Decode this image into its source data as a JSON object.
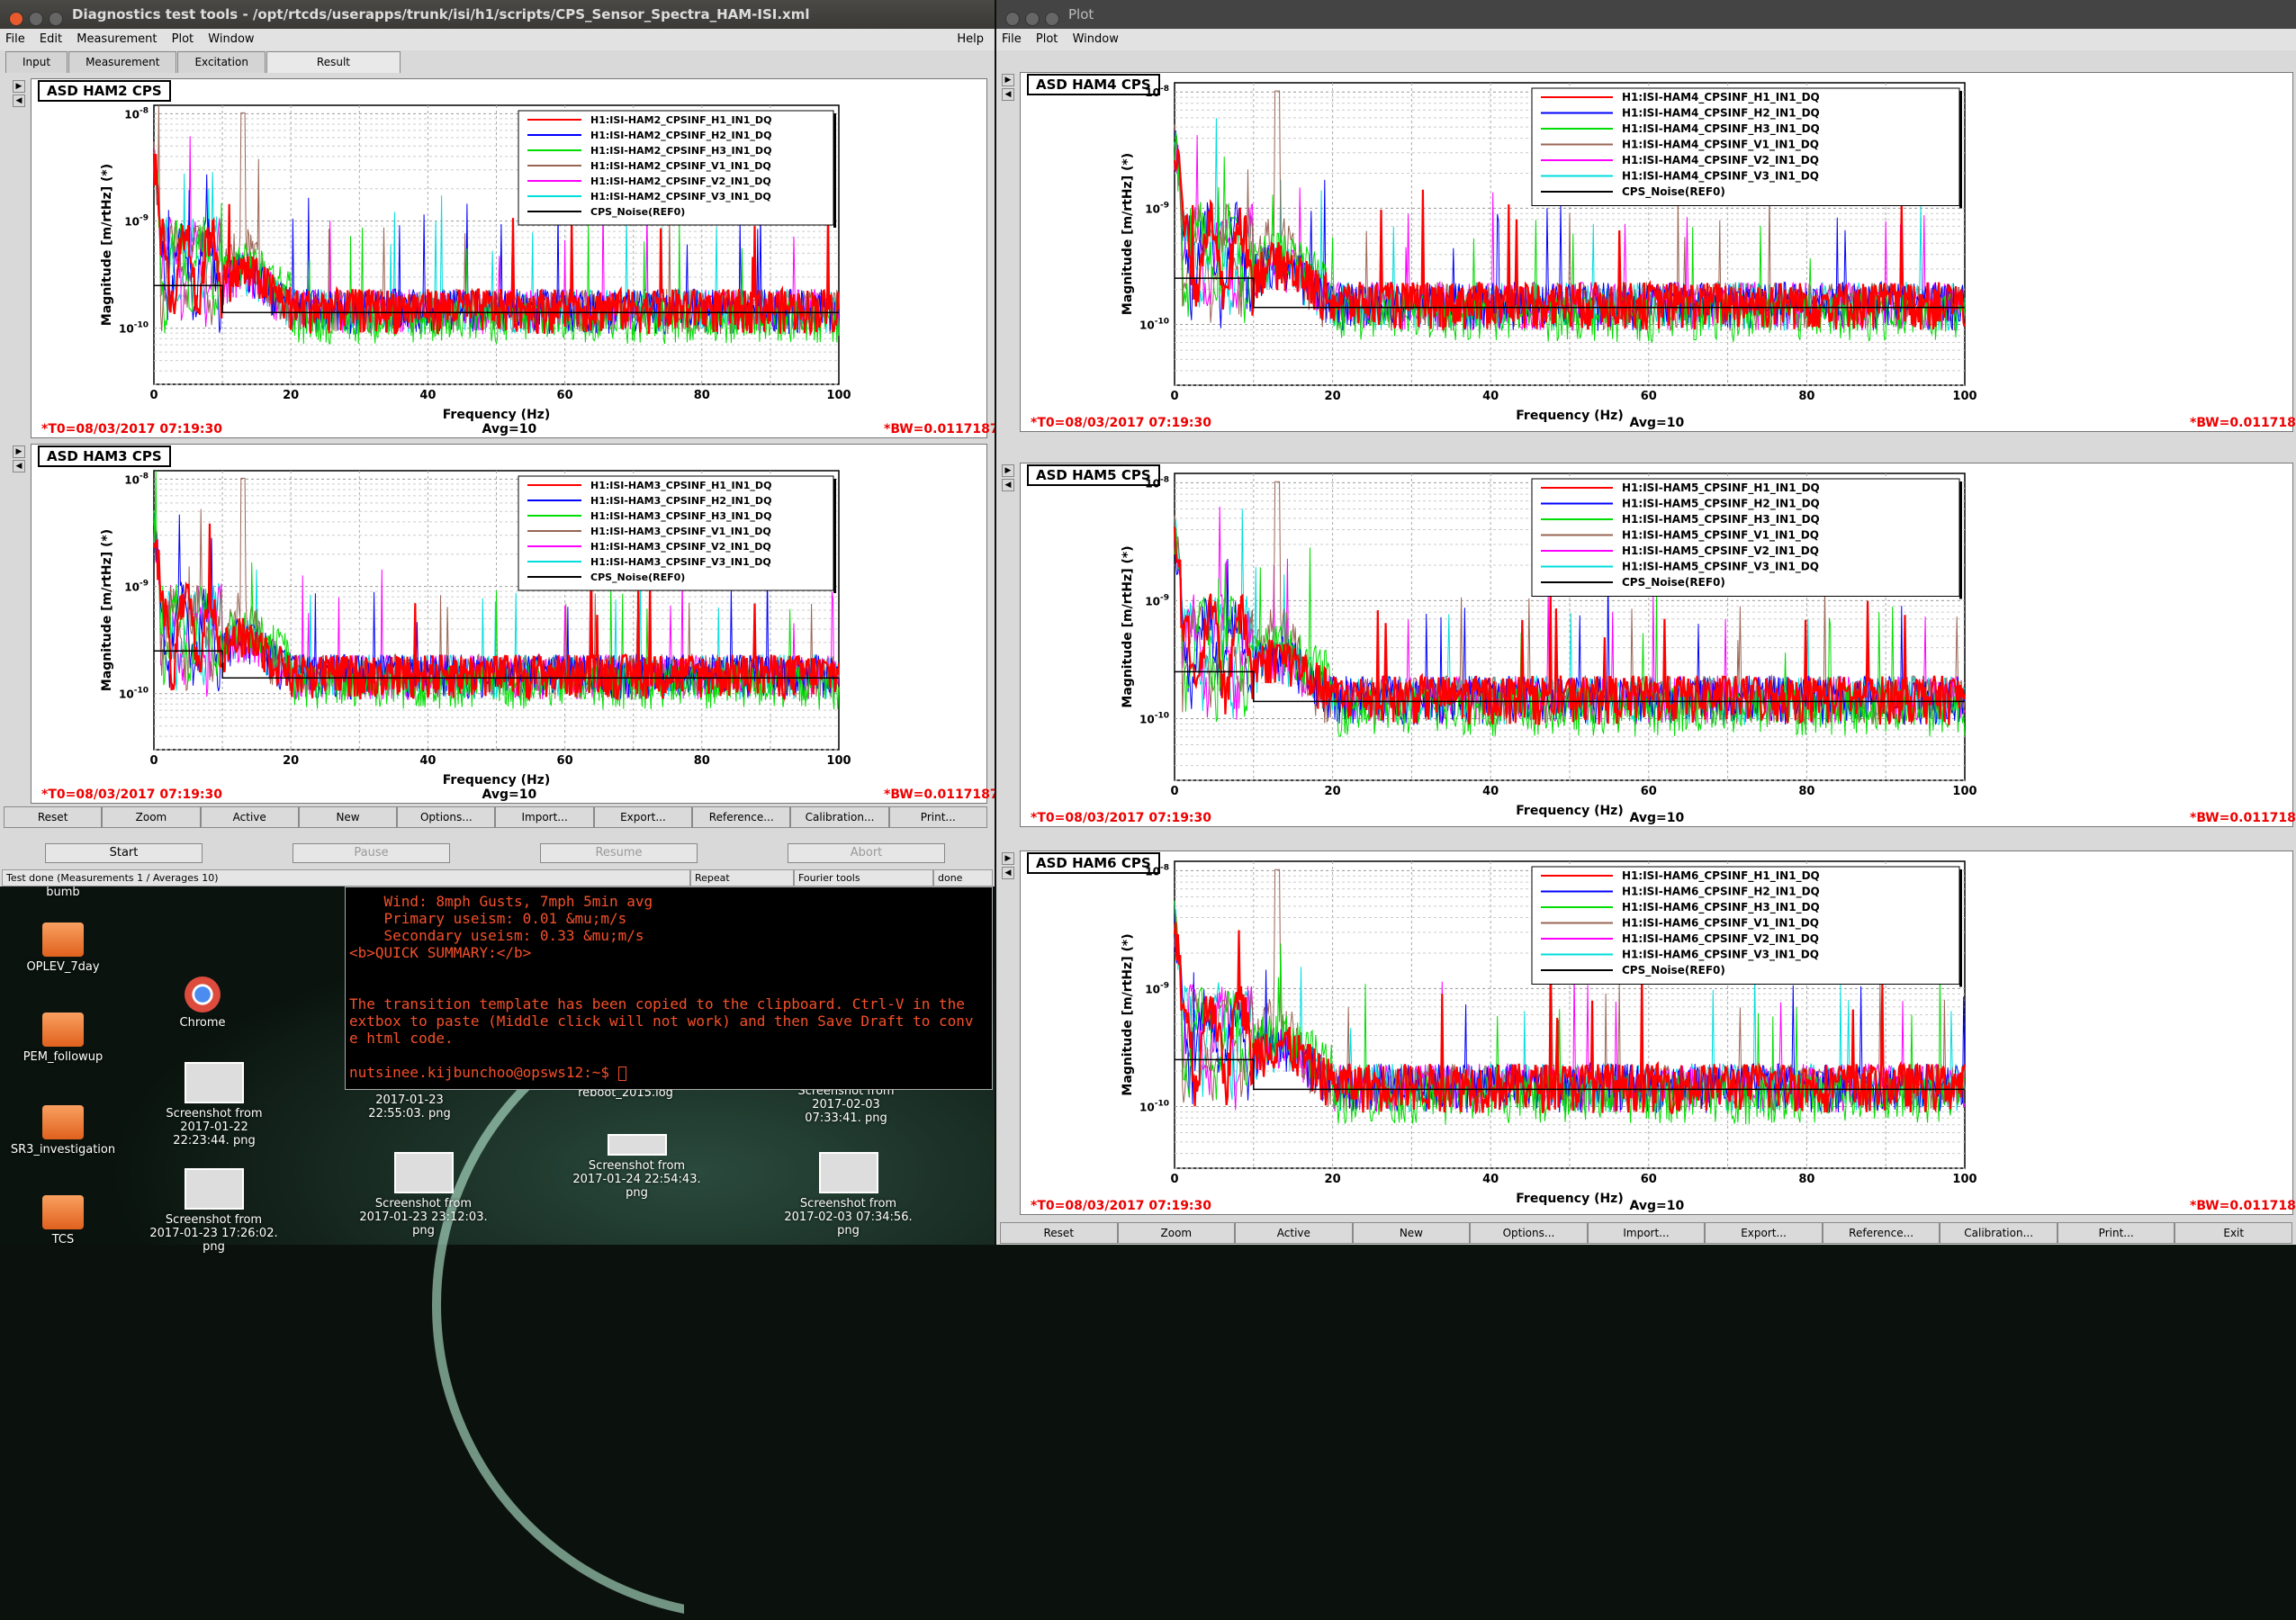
{
  "desktop": {
    "items": [
      {
        "label": "bumb",
        "kind": "text"
      },
      {
        "label": "OPLEV_7day",
        "kind": "folder"
      },
      {
        "label": "Chrome",
        "kind": "app"
      },
      {
        "label": "PEM_followup",
        "kind": "folder"
      },
      {
        "label": "Screenshot from 2017-01-22 22:23:44. png",
        "kind": "thumb"
      },
      {
        "label": "SR3_investigation",
        "kind": "folder"
      },
      {
        "label": "2017-01-23 22:55:03. png",
        "kind": "thumb"
      },
      {
        "label": "reboot_2015.log",
        "kind": "file"
      },
      {
        "label": "Screenshot from 2017-02-03 07:33:41. png",
        "kind": "thumb"
      },
      {
        "label": "Screenshot from 2017-01-23 17:26:02. png",
        "kind": "thumb"
      },
      {
        "label": "Screenshot from 2017-01-23 23:12:03. png",
        "kind": "thumb"
      },
      {
        "label": "Screenshot from 2017-01-24 22:54:43. png",
        "kind": "thumb"
      },
      {
        "label": "Screenshot from 2017-02-03 07:34:56. png",
        "kind": "thumb"
      },
      {
        "label": "TCS",
        "kind": "folder"
      }
    ]
  },
  "terminal": {
    "lines": [
      "    Wind: 8mph Gusts, 7mph 5min avg",
      "    Primary useism: 0.01 &mu;m/s",
      "    Secondary useism: 0.33 &mu;m/s",
      "<b>QUICK SUMMARY:</b>",
      "",
      "",
      "The transition template has been copied to the clipboard. Ctrl-V in the",
      "extbox to paste (Middle click will not work) and then Save Draft to conv",
      "e html code.",
      "",
      "nutsinee.kijbunchoo@opsws12:~$ "
    ]
  },
  "left_window": {
    "title": "Diagnostics test tools - /opt/rtcds/userapps/trunk/isi/h1/scripts/CPS_Sensor_Spectra_HAM-ISI.xml",
    "menu": [
      "File",
      "Edit",
      "Measurement",
      "Plot",
      "Window"
    ],
    "help": "Help",
    "tabs": [
      "Input",
      "Measurement",
      "Excitation",
      "Result"
    ],
    "active_tab": "Result",
    "buttons": [
      "Reset",
      "Zoom",
      "Active",
      "New",
      "Options...",
      "Import...",
      "Export...",
      "Reference...",
      "Calibration...",
      "Print..."
    ],
    "controls": {
      "start": "Start",
      "pause": "Pause",
      "resume": "Resume",
      "abort": "Abort"
    },
    "status": {
      "message": "Test done (Measurements 1 / Averages 10)",
      "repeat": "Repeat",
      "fourier": "Fourier tools",
      "done": "done"
    }
  },
  "right_window": {
    "title": "Plot",
    "menu": [
      "File",
      "Plot",
      "Window"
    ],
    "buttons": [
      "Reset",
      "Zoom",
      "Active",
      "New",
      "Options...",
      "Import...",
      "Export...",
      "Reference...",
      "Calibration...",
      "Print...",
      "Exit"
    ]
  },
  "plot_common": {
    "xlabel": "Frequency (Hz)",
    "ylabel": "Magnitude [m/rtHz] (*)",
    "t0": "*T0=08/03/2017 07:19:30",
    "avg": "Avg=10",
    "bw": "*BW=0.0117187"
  },
  "chart_data": [
    {
      "type": "line",
      "title": "ASD HAM2 CPS",
      "xlabel": "Frequency (Hz)",
      "ylabel": "Magnitude [m/rtHz] (*)",
      "xlim": [
        0,
        100
      ],
      "ylim": [
        3e-11,
        1.2e-08
      ],
      "log_y": true,
      "x_ticks": [
        0,
        20,
        40,
        60,
        80,
        100
      ],
      "y_ticks": [
        "10^-8",
        "10^-9",
        "10^-10"
      ],
      "legend_position": "top-right",
      "grid": true,
      "series": [
        {
          "name": "H1:ISI-HAM2_CPSINF_H1_IN1_DQ",
          "color": "#ff0000"
        },
        {
          "name": "H1:ISI-HAM2_CPSINF_H2_IN1_DQ",
          "color": "#0000ff"
        },
        {
          "name": "H1:ISI-HAM2_CPSINF_H3_IN1_DQ",
          "color": "#00dd00"
        },
        {
          "name": "H1:ISI-HAM2_CPSINF_V1_IN1_DQ",
          "color": "#996655"
        },
        {
          "name": "H1:ISI-HAM2_CPSINF_V2_IN1_DQ",
          "color": "#ff00ff"
        },
        {
          "name": "H1:ISI-HAM2_CPSINF_V3_IN1_DQ",
          "color": "#00dddd"
        },
        {
          "name": "CPS_Noise(REF0)",
          "color": "#000000"
        }
      ],
      "noise_floor": 1.6e-10,
      "ref_level": {
        "x": [
          0,
          10,
          10,
          100
        ],
        "y": [
          2.5e-10,
          2.5e-10,
          1.4e-10,
          1.4e-10
        ]
      },
      "peak_hz": 13
    },
    {
      "type": "line",
      "title": "ASD HAM3 CPS",
      "xlabel": "Frequency (Hz)",
      "ylabel": "Magnitude [m/rtHz] (*)",
      "xlim": [
        0,
        100
      ],
      "ylim": [
        3e-11,
        1.2e-08
      ],
      "log_y": true,
      "x_ticks": [
        0,
        20,
        40,
        60,
        80,
        100
      ],
      "y_ticks": [
        "10^-8",
        "10^-9",
        "10^-10"
      ],
      "legend_position": "top-right",
      "grid": true,
      "series": [
        {
          "name": "H1:ISI-HAM3_CPSINF_H1_IN1_DQ",
          "color": "#ff0000"
        },
        {
          "name": "H1:ISI-HAM3_CPSINF_H2_IN1_DQ",
          "color": "#0000ff"
        },
        {
          "name": "H1:ISI-HAM3_CPSINF_H3_IN1_DQ",
          "color": "#00dd00"
        },
        {
          "name": "H1:ISI-HAM3_CPSINF_V1_IN1_DQ",
          "color": "#996655"
        },
        {
          "name": "H1:ISI-HAM3_CPSINF_V2_IN1_DQ",
          "color": "#ff00ff"
        },
        {
          "name": "H1:ISI-HAM3_CPSINF_V3_IN1_DQ",
          "color": "#00dddd"
        },
        {
          "name": "CPS_Noise(REF0)",
          "color": "#000000"
        }
      ],
      "noise_floor": 1.6e-10,
      "ref_level": {
        "x": [
          0,
          10,
          10,
          100
        ],
        "y": [
          2.5e-10,
          2.5e-10,
          1.4e-10,
          1.4e-10
        ]
      },
      "peak_hz": 13
    },
    {
      "type": "line",
      "title": "ASD HAM4 CPS",
      "xlabel": "Frequency (Hz)",
      "ylabel": "Magnitude [m/rtHz] (*)",
      "xlim": [
        0,
        100
      ],
      "ylim": [
        3e-11,
        1.2e-08
      ],
      "log_y": true,
      "x_ticks": [
        0,
        20,
        40,
        60,
        80,
        100
      ],
      "y_ticks": [
        "10^-8",
        "10^-9",
        "10^-10"
      ],
      "legend_position": "top-right",
      "grid": true,
      "series": [
        {
          "name": "H1:ISI-HAM4_CPSINF_H1_IN1_DQ",
          "color": "#ff0000"
        },
        {
          "name": "H1:ISI-HAM4_CPSINF_H2_IN1_DQ",
          "color": "#0000ff"
        },
        {
          "name": "H1:ISI-HAM4_CPSINF_H3_IN1_DQ",
          "color": "#00dd00"
        },
        {
          "name": "H1:ISI-HAM4_CPSINF_V1_IN1_DQ",
          "color": "#996655"
        },
        {
          "name": "H1:ISI-HAM4_CPSINF_V2_IN1_DQ",
          "color": "#ff00ff"
        },
        {
          "name": "H1:ISI-HAM4_CPSINF_V3_IN1_DQ",
          "color": "#00dddd"
        },
        {
          "name": "CPS_Noise(REF0)",
          "color": "#000000"
        }
      ],
      "noise_floor": 1.6e-10,
      "ref_level": {
        "x": [
          0,
          10,
          10,
          100
        ],
        "y": [
          2.5e-10,
          2.5e-10,
          1.4e-10,
          1.4e-10
        ]
      },
      "peak_hz": 13
    },
    {
      "type": "line",
      "title": "ASD HAM5 CPS",
      "xlabel": "Frequency (Hz)",
      "ylabel": "Magnitude [m/rtHz] (*)",
      "xlim": [
        0,
        100
      ],
      "ylim": [
        3e-11,
        1.2e-08
      ],
      "log_y": true,
      "x_ticks": [
        0,
        20,
        40,
        60,
        80,
        100
      ],
      "y_ticks": [
        "10^-8",
        "10^-9",
        "10^-10"
      ],
      "legend_position": "top-right",
      "grid": true,
      "series": [
        {
          "name": "H1:ISI-HAM5_CPSINF_H1_IN1_DQ",
          "color": "#ff0000"
        },
        {
          "name": "H1:ISI-HAM5_CPSINF_H2_IN1_DQ",
          "color": "#0000ff"
        },
        {
          "name": "H1:ISI-HAM5_CPSINF_H3_IN1_DQ",
          "color": "#00dd00"
        },
        {
          "name": "H1:ISI-HAM5_CPSINF_V1_IN1_DQ",
          "color": "#996655"
        },
        {
          "name": "H1:ISI-HAM5_CPSINF_V2_IN1_DQ",
          "color": "#ff00ff"
        },
        {
          "name": "H1:ISI-HAM5_CPSINF_V3_IN1_DQ",
          "color": "#00dddd"
        },
        {
          "name": "CPS_Noise(REF0)",
          "color": "#000000"
        }
      ],
      "noise_floor": 1.6e-10,
      "ref_level": {
        "x": [
          0,
          10,
          10,
          100
        ],
        "y": [
          2.5e-10,
          2.5e-10,
          1.4e-10,
          1.4e-10
        ]
      },
      "peak_hz": 13
    },
    {
      "type": "line",
      "title": "ASD HAM6 CPS",
      "xlabel": "Frequency (Hz)",
      "ylabel": "Magnitude [m/rtHz] (*)",
      "xlim": [
        0,
        100
      ],
      "ylim": [
        3e-11,
        1.2e-08
      ],
      "log_y": true,
      "x_ticks": [
        0,
        20,
        40,
        60,
        80,
        100
      ],
      "y_ticks": [
        "10^-8",
        "10^-9",
        "10^-10"
      ],
      "legend_position": "top-right",
      "grid": true,
      "series": [
        {
          "name": "H1:ISI-HAM6_CPSINF_H1_IN1_DQ",
          "color": "#ff0000"
        },
        {
          "name": "H1:ISI-HAM6_CPSINF_H2_IN1_DQ",
          "color": "#0000ff"
        },
        {
          "name": "H1:ISI-HAM6_CPSINF_H3_IN1_DQ",
          "color": "#00dd00"
        },
        {
          "name": "H1:ISI-HAM6_CPSINF_V1_IN1_DQ",
          "color": "#996655"
        },
        {
          "name": "H1:ISI-HAM6_CPSINF_V2_IN1_DQ",
          "color": "#ff00ff"
        },
        {
          "name": "H1:ISI-HAM6_CPSINF_V3_IN1_DQ",
          "color": "#00dddd"
        },
        {
          "name": "CPS_Noise(REF0)",
          "color": "#000000"
        }
      ],
      "noise_floor": 1.6e-10,
      "ref_level": {
        "x": [
          0,
          10,
          10,
          100
        ],
        "y": [
          2.5e-10,
          2.5e-10,
          1.4e-10,
          1.4e-10
        ]
      },
      "peak_hz": 13
    }
  ]
}
